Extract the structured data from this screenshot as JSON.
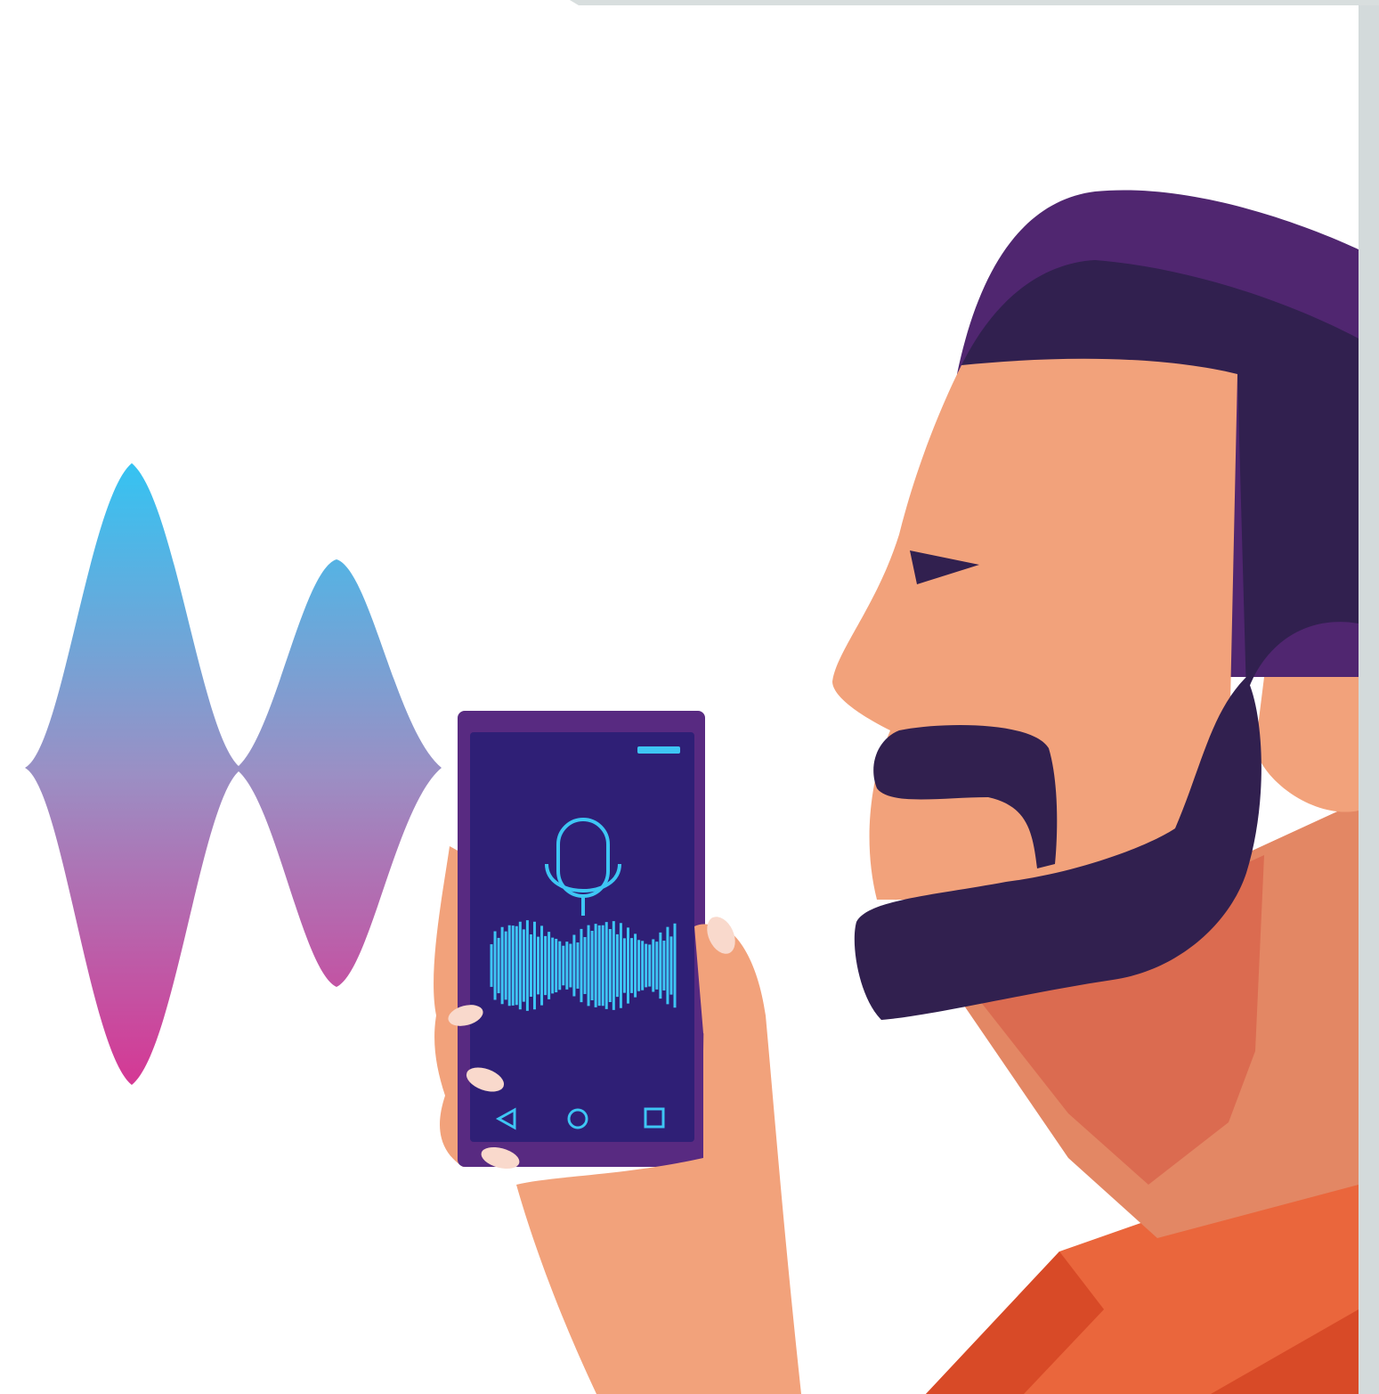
{
  "illustration": {
    "subject": "voice-assistant-user",
    "icons": [
      "sound-wave-icon",
      "microphone-icon",
      "audio-waveform-icon",
      "nav-back-icon",
      "nav-home-icon",
      "nav-recents-icon"
    ]
  },
  "colors": {
    "background": "#ffffff",
    "frame_right": "#d3dadb",
    "frame_top": "#d8dede",
    "wave_top": "#35c3f2",
    "wave_mid": "#9b8fc4",
    "wave_bottom": "#d53894",
    "phone_body": "#582a81",
    "phone_screen": "#2f1f76",
    "screen_accent": "#3ec6f4",
    "hair": "#502670",
    "hair_dark": "#31204f",
    "skin": "#f2a27b",
    "skin_shadow": "#e38764",
    "neck_shadow": "#db6b50",
    "shirt": "#ea663c",
    "shirt_dark": "#d84a27",
    "fingernail": "#f9d9cc"
  }
}
